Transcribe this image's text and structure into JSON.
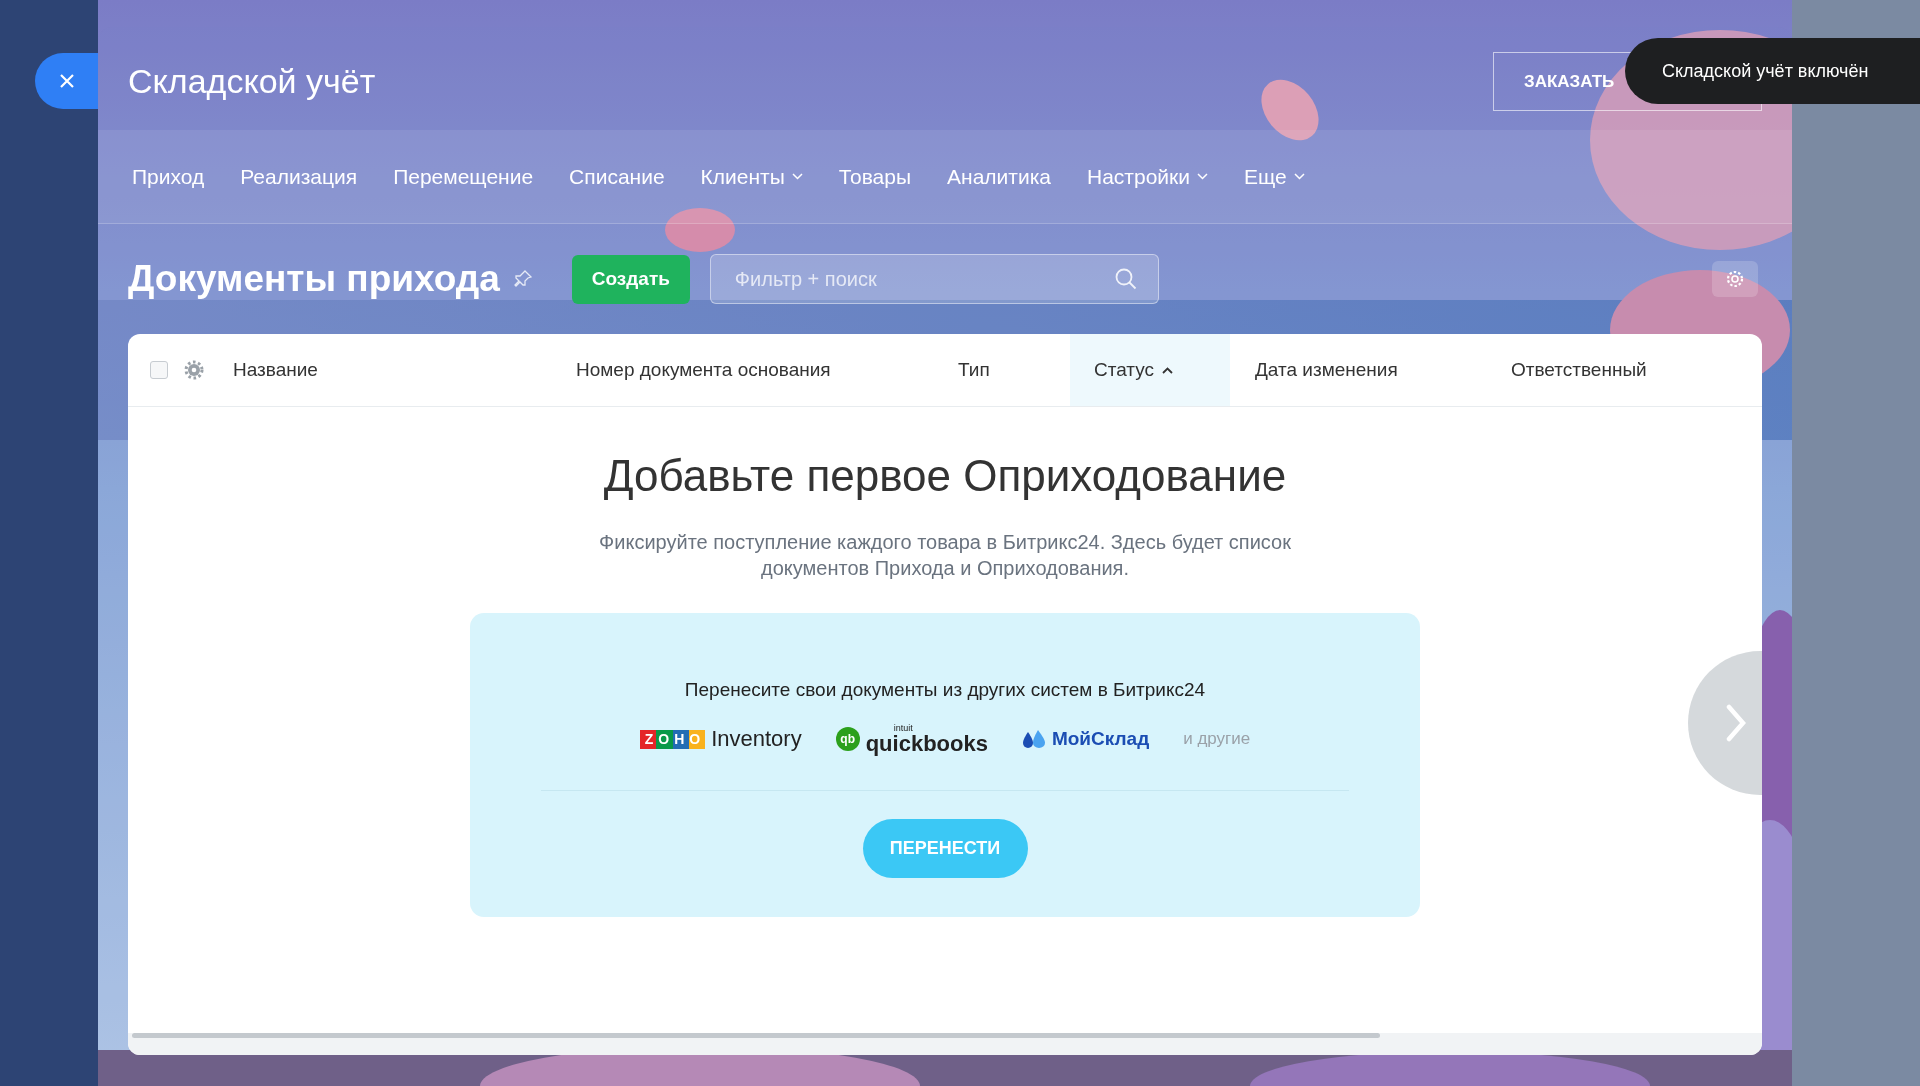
{
  "title": "Складской учёт",
  "order_button": {
    "label": "ЗАКАЗАТЬ"
  },
  "toast": {
    "text": "Складской учёт включён"
  },
  "nav": [
    {
      "label": "Приход",
      "dropdown": false
    },
    {
      "label": "Реализация",
      "dropdown": false
    },
    {
      "label": "Перемещение",
      "dropdown": false
    },
    {
      "label": "Списание",
      "dropdown": false
    },
    {
      "label": "Клиенты",
      "dropdown": true
    },
    {
      "label": "Товары",
      "dropdown": false
    },
    {
      "label": "Аналитика",
      "dropdown": false
    },
    {
      "label": "Настройки",
      "dropdown": true
    },
    {
      "label": "Еще",
      "dropdown": true
    }
  ],
  "page_title": "Документы прихода",
  "create_button": {
    "label": "Создать"
  },
  "search": {
    "placeholder": "Фильтр + поиск"
  },
  "table": {
    "select_all": {
      "checked": false
    },
    "columns": [
      {
        "label": "Название",
        "sorted": false
      },
      {
        "label": "Номер документа основания",
        "sorted": false
      },
      {
        "label": "Тип",
        "sorted": false
      },
      {
        "label": "Статус",
        "sorted": true
      },
      {
        "label": "Дата изменения",
        "sorted": false
      },
      {
        "label": "Ответственный",
        "sorted": false
      }
    ]
  },
  "empty_state": {
    "heading": "Добавьте первое Оприходование",
    "text": "Фиксируйте поступление каждого товара в Битрикс24. Здесь будет список документов Прихода и Оприходования.",
    "import": {
      "prompt": "Перенесите свои документы из других систем в Битрикс24",
      "logos": [
        {
          "kind": "zoho",
          "mark": "ZOHO",
          "text": "Inventory"
        },
        {
          "kind": "quickbooks",
          "mark": "qb",
          "over": "intuit",
          "text": "quickbooks"
        },
        {
          "kind": "moysklad",
          "text": "МойСклад"
        }
      ],
      "others": "и другие",
      "button": "ПЕРЕНЕСТИ"
    }
  }
}
